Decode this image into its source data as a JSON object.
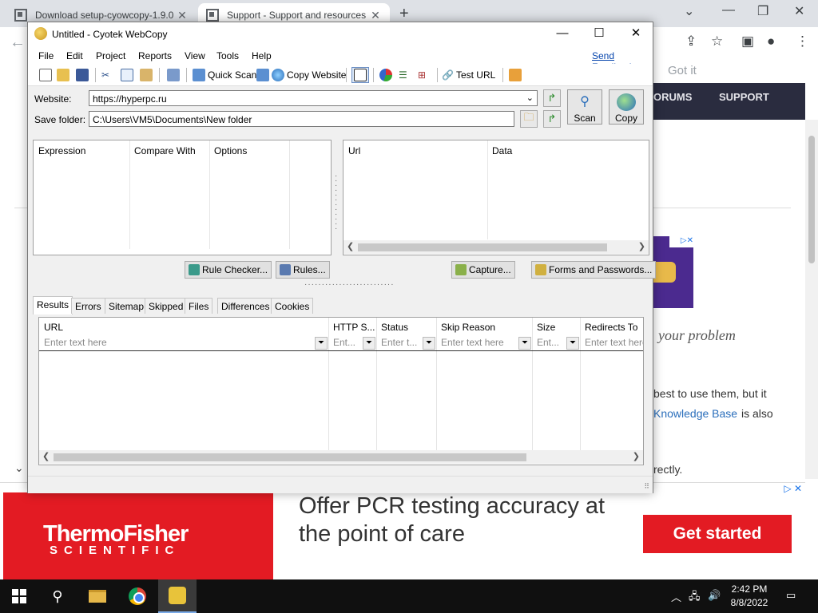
{
  "browser": {
    "tabs": [
      {
        "title": "Download setup-cyowcopy-1.9.0"
      },
      {
        "title": "Support - Support and resources"
      }
    ],
    "new_tab": "+",
    "got_it": "Got it",
    "site_nav": [
      "ORUMS",
      "SUPPORT"
    ],
    "page_text": {
      "heading_fragment": "your problem",
      "line1": "best to use them, but it",
      "line2_link": "Knowledge Base",
      "line2_rest": "is also",
      "line3": "rectly."
    },
    "ad": {
      "brand_line1": "ThermoFisher",
      "brand_line2": "SCIENTIFIC",
      "copy": "Offer PCR testing accuracy at the point of care",
      "cta": "Get started"
    }
  },
  "taskbar": {
    "time": "2:42 PM",
    "date": "8/8/2022"
  },
  "app": {
    "title": "Untitled - Cyotek WebCopy",
    "menu": [
      "File",
      "Edit",
      "Project",
      "Reports",
      "View",
      "Tools",
      "Help"
    ],
    "send_feedback": "Send Feedback",
    "toolbar": {
      "quick_scan": "Quick Scan",
      "copy_website": "Copy Website",
      "test_url": "Test URL"
    },
    "website_label": "Website:",
    "website_value": "https://hyperpc.ru",
    "save_folder_label": "Save folder:",
    "save_folder_value": "C:\\Users\\VM5\\Documents\\New folder",
    "scan_label": "Scan",
    "copy_label": "Copy",
    "rules_columns": [
      "Expression",
      "Compare With",
      "Options"
    ],
    "data_columns": [
      "Url",
      "Data"
    ],
    "buttons": {
      "rule_checker": "Rule Checker...",
      "rules": "Rules...",
      "capture": "Capture...",
      "forms_passwords": "Forms and Passwords..."
    },
    "result_tabs": [
      "Results",
      "Errors",
      "Sitemap",
      "Skipped",
      "Files",
      "Differences",
      "Cookies"
    ],
    "results_columns": [
      {
        "header": "URL",
        "filter": "Enter text here"
      },
      {
        "header": "HTTP S...",
        "filter": "Ent..."
      },
      {
        "header": "Status",
        "filter": "Enter t..."
      },
      {
        "header": "Skip Reason",
        "filter": "Enter text here"
      },
      {
        "header": "Size",
        "filter": "Ent..."
      },
      {
        "header": "Redirects To",
        "filter": "Enter text here"
      }
    ]
  }
}
